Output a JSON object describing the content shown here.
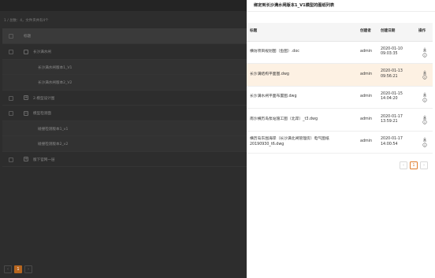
{
  "left": {
    "breadcrumb": "1 / 总数：4，文件夹共有4个",
    "header": {
      "col_title": "标题"
    },
    "rows": [
      {
        "toggle": "",
        "label": "长沙满水闸",
        "level": 0
      },
      {
        "toggle": "",
        "label": "长沙满水闸版本1_V1",
        "level": 1
      },
      {
        "toggle": "",
        "label": "长沙满水闸版本2_V2",
        "level": 1
      },
      {
        "toggle": "+",
        "label": "2.模型设计图",
        "level": 0
      },
      {
        "toggle": "−",
        "label": "模型检测面",
        "level": 0
      },
      {
        "toggle": "",
        "label": "碰撞检测版本1_v1",
        "level": 1
      },
      {
        "toggle": "",
        "label": "碰撞检测版本2_v2",
        "level": 1
      },
      {
        "toggle": "+",
        "label": "版下官网一层",
        "level": 0
      }
    ],
    "pager": {
      "prev": "‹",
      "current": "1",
      "next": "›"
    }
  },
  "drawer": {
    "title": "绑定到长沙满水闸版本1_V1模型的图纸列表",
    "columns": {
      "name": "标题",
      "creator": "创建者",
      "date": "创建日期",
      "op": "操作"
    },
    "rows": [
      {
        "name": "横坊项目规划图（鱼图）.doc",
        "creator": "admin",
        "date": "2020-01-10 09:03:35"
      },
      {
        "name": "长沙满结构平面图.dwg",
        "creator": "admin",
        "date": "2020-01-13 09:56:21"
      },
      {
        "name": "长沙满水闸平面布置图.dwg",
        "creator": "admin",
        "date": "2020-01-15 14:04:20"
      },
      {
        "name": "南沙横历岛泵站施工图（北岸）_t3.dwg",
        "creator": "admin",
        "date": "2020-01-17 13:59:21"
      },
      {
        "name": "横历岛东围海岸（长沙满北闸管理房）电气图纸20190930_t6.dwg",
        "creator": "admin",
        "date": "2020-01-17 14:00:54"
      }
    ],
    "highlight_color": "#fdf1e3",
    "accent_color": "#e07b2a",
    "pager": {
      "prev": "‹",
      "current": "1",
      "next": "›"
    }
  }
}
